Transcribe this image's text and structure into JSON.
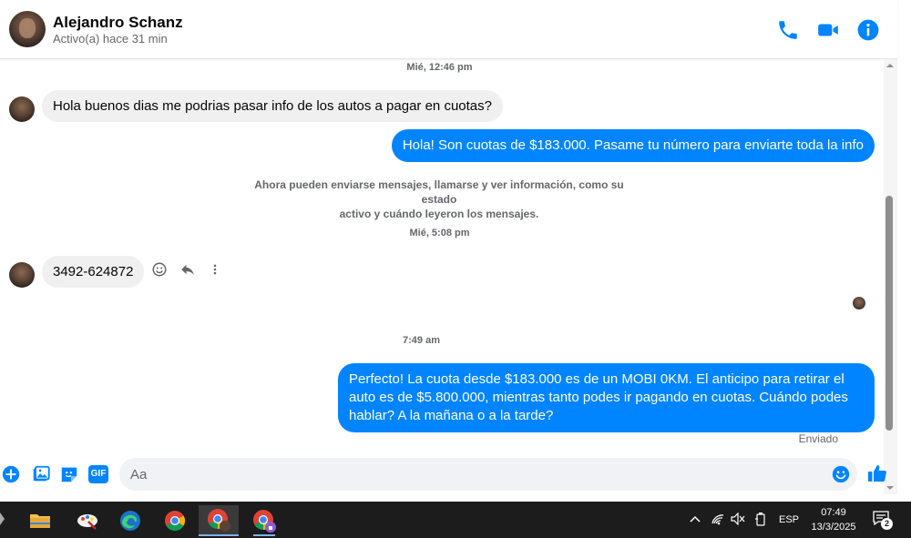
{
  "header": {
    "contact_name": "Alejandro Schanz",
    "contact_status": "Activo(a) hace 31 min",
    "icons": [
      "phone-icon",
      "video-icon",
      "info-icon"
    ],
    "accent_color": "#0084ff"
  },
  "conversation": {
    "timestamp_1": "Mié, 12:46 pm",
    "incoming_1": "Hola buenos dias me podrias pasar info de los autos a pagar en cuotas?",
    "outgoing_1": "Hola! Son cuotas de $183.000. Pasame tu número para enviarte toda la info",
    "notice_line_1": "Ahora pueden enviarse mensajes, llamarse y ver información, como su estado",
    "notice_line_2": "activo y cuándo leyeron los mensajes.",
    "timestamp_2": "Mié, 5:08 pm",
    "incoming_2": "3492-624872",
    "timestamp_3": "7:49 am",
    "outgoing_2_line_1": "Perfecto! La cuota desde $183.000 es de un MOBI 0KM. El anticipo para retirar el",
    "outgoing_2_line_2": "auto es de $5.800.000, mientras tanto podes ir pagando en cuotas. Cuándo podes",
    "outgoing_2_line_3": "hablar? A la mañana o a la tarde?",
    "sent_status": "Enviado"
  },
  "composer": {
    "placeholder": "Aa",
    "gif_label": "GIF"
  },
  "taskbar": {
    "language": "ESP",
    "time": "07:49",
    "date": "13/3/2025",
    "notification_count": "2"
  }
}
